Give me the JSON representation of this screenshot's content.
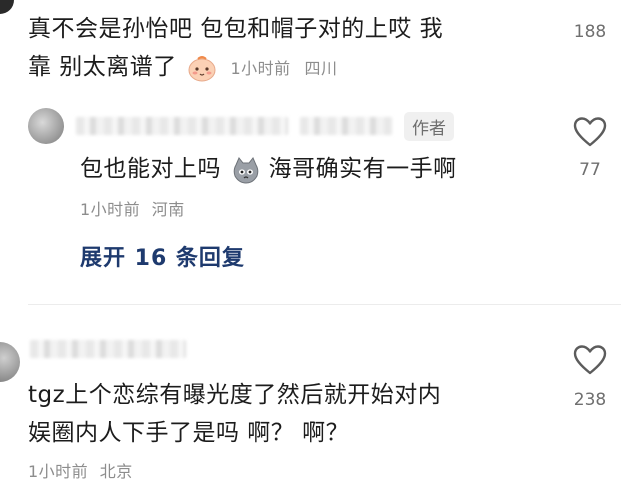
{
  "comments": [
    {
      "text_line1": "真不会是孙怡吧 包包和帽子对的上哎 我",
      "text_line2": "靠 别太离谱了",
      "emoji": "blush-face-icon",
      "time": "1小时前",
      "location": "四川",
      "likes": "188"
    },
    {
      "author_tag": "作者",
      "text": "包也能对上吗",
      "emoji": "cat-face-icon",
      "text_after": "海哥确实有一手啊",
      "time": "1小时前",
      "location": "河南",
      "likes": "77"
    },
    {
      "text_line1": "tgz上个恋综有曝光度了然后就开始对内",
      "text_line2": "娱圈内人下手了是吗 啊？ 啊？",
      "time": "1小时前",
      "location": "北京",
      "likes": "238"
    }
  ],
  "expand_replies": "展开 16 条回复"
}
